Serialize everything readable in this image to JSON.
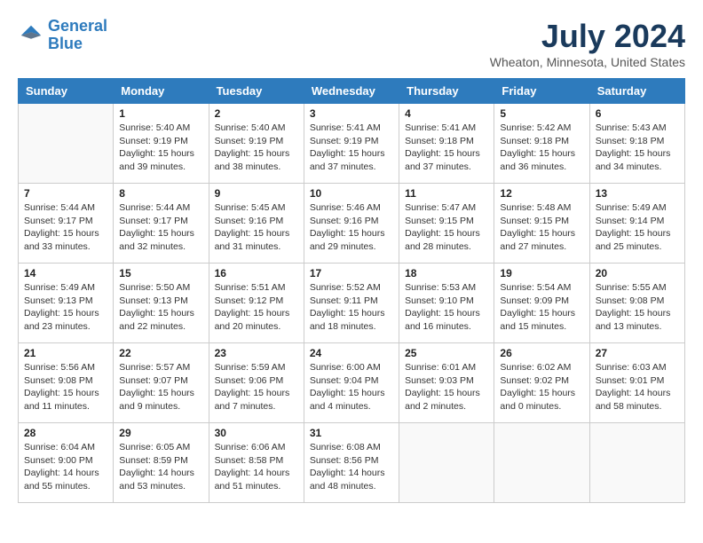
{
  "header": {
    "logo_line1": "General",
    "logo_line2": "Blue",
    "month_year": "July 2024",
    "location": "Wheaton, Minnesota, United States"
  },
  "weekdays": [
    "Sunday",
    "Monday",
    "Tuesday",
    "Wednesday",
    "Thursday",
    "Friday",
    "Saturday"
  ],
  "weeks": [
    [
      {
        "day": "",
        "info": ""
      },
      {
        "day": "1",
        "info": "Sunrise: 5:40 AM\nSunset: 9:19 PM\nDaylight: 15 hours\nand 39 minutes."
      },
      {
        "day": "2",
        "info": "Sunrise: 5:40 AM\nSunset: 9:19 PM\nDaylight: 15 hours\nand 38 minutes."
      },
      {
        "day": "3",
        "info": "Sunrise: 5:41 AM\nSunset: 9:19 PM\nDaylight: 15 hours\nand 37 minutes."
      },
      {
        "day": "4",
        "info": "Sunrise: 5:41 AM\nSunset: 9:18 PM\nDaylight: 15 hours\nand 37 minutes."
      },
      {
        "day": "5",
        "info": "Sunrise: 5:42 AM\nSunset: 9:18 PM\nDaylight: 15 hours\nand 36 minutes."
      },
      {
        "day": "6",
        "info": "Sunrise: 5:43 AM\nSunset: 9:18 PM\nDaylight: 15 hours\nand 34 minutes."
      }
    ],
    [
      {
        "day": "7",
        "info": "Sunrise: 5:44 AM\nSunset: 9:17 PM\nDaylight: 15 hours\nand 33 minutes."
      },
      {
        "day": "8",
        "info": "Sunrise: 5:44 AM\nSunset: 9:17 PM\nDaylight: 15 hours\nand 32 minutes."
      },
      {
        "day": "9",
        "info": "Sunrise: 5:45 AM\nSunset: 9:16 PM\nDaylight: 15 hours\nand 31 minutes."
      },
      {
        "day": "10",
        "info": "Sunrise: 5:46 AM\nSunset: 9:16 PM\nDaylight: 15 hours\nand 29 minutes."
      },
      {
        "day": "11",
        "info": "Sunrise: 5:47 AM\nSunset: 9:15 PM\nDaylight: 15 hours\nand 28 minutes."
      },
      {
        "day": "12",
        "info": "Sunrise: 5:48 AM\nSunset: 9:15 PM\nDaylight: 15 hours\nand 27 minutes."
      },
      {
        "day": "13",
        "info": "Sunrise: 5:49 AM\nSunset: 9:14 PM\nDaylight: 15 hours\nand 25 minutes."
      }
    ],
    [
      {
        "day": "14",
        "info": "Sunrise: 5:49 AM\nSunset: 9:13 PM\nDaylight: 15 hours\nand 23 minutes."
      },
      {
        "day": "15",
        "info": "Sunrise: 5:50 AM\nSunset: 9:13 PM\nDaylight: 15 hours\nand 22 minutes."
      },
      {
        "day": "16",
        "info": "Sunrise: 5:51 AM\nSunset: 9:12 PM\nDaylight: 15 hours\nand 20 minutes."
      },
      {
        "day": "17",
        "info": "Sunrise: 5:52 AM\nSunset: 9:11 PM\nDaylight: 15 hours\nand 18 minutes."
      },
      {
        "day": "18",
        "info": "Sunrise: 5:53 AM\nSunset: 9:10 PM\nDaylight: 15 hours\nand 16 minutes."
      },
      {
        "day": "19",
        "info": "Sunrise: 5:54 AM\nSunset: 9:09 PM\nDaylight: 15 hours\nand 15 minutes."
      },
      {
        "day": "20",
        "info": "Sunrise: 5:55 AM\nSunset: 9:08 PM\nDaylight: 15 hours\nand 13 minutes."
      }
    ],
    [
      {
        "day": "21",
        "info": "Sunrise: 5:56 AM\nSunset: 9:08 PM\nDaylight: 15 hours\nand 11 minutes."
      },
      {
        "day": "22",
        "info": "Sunrise: 5:57 AM\nSunset: 9:07 PM\nDaylight: 15 hours\nand 9 minutes."
      },
      {
        "day": "23",
        "info": "Sunrise: 5:59 AM\nSunset: 9:06 PM\nDaylight: 15 hours\nand 7 minutes."
      },
      {
        "day": "24",
        "info": "Sunrise: 6:00 AM\nSunset: 9:04 PM\nDaylight: 15 hours\nand 4 minutes."
      },
      {
        "day": "25",
        "info": "Sunrise: 6:01 AM\nSunset: 9:03 PM\nDaylight: 15 hours\nand 2 minutes."
      },
      {
        "day": "26",
        "info": "Sunrise: 6:02 AM\nSunset: 9:02 PM\nDaylight: 15 hours\nand 0 minutes."
      },
      {
        "day": "27",
        "info": "Sunrise: 6:03 AM\nSunset: 9:01 PM\nDaylight: 14 hours\nand 58 minutes."
      }
    ],
    [
      {
        "day": "28",
        "info": "Sunrise: 6:04 AM\nSunset: 9:00 PM\nDaylight: 14 hours\nand 55 minutes."
      },
      {
        "day": "29",
        "info": "Sunrise: 6:05 AM\nSunset: 8:59 PM\nDaylight: 14 hours\nand 53 minutes."
      },
      {
        "day": "30",
        "info": "Sunrise: 6:06 AM\nSunset: 8:58 PM\nDaylight: 14 hours\nand 51 minutes."
      },
      {
        "day": "31",
        "info": "Sunrise: 6:08 AM\nSunset: 8:56 PM\nDaylight: 14 hours\nand 48 minutes."
      },
      {
        "day": "",
        "info": ""
      },
      {
        "day": "",
        "info": ""
      },
      {
        "day": "",
        "info": ""
      }
    ]
  ]
}
